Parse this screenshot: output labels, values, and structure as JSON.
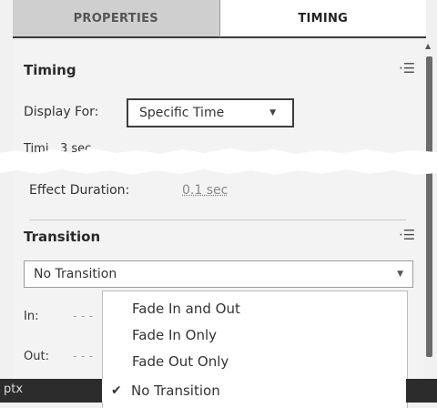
{
  "tabs": [
    {
      "label": "PROPERTIES"
    },
    {
      "label": "TIMING"
    }
  ],
  "timing_section": {
    "title": "Timing",
    "display_for_label": "Display For:",
    "display_for_value": "Specific Time",
    "timing_label": "Timi",
    "timing_value": "3 sec",
    "effect_duration_label": "Effect Duration:",
    "effect_duration_value": "0.1 sec"
  },
  "transition_section": {
    "title": "Transition",
    "selected": "No Transition",
    "in_label": "In:",
    "out_label": "Out:",
    "options": [
      "Fade In and Out",
      "Fade In Only",
      "Fade Out Only",
      "No Transition"
    ],
    "checked_option": "No Transition"
  },
  "bottom_bar": {
    "text": "ptx"
  },
  "colors": {
    "accent": "#3d3d3d",
    "panel_bg": "#f3f3f3",
    "dark_bar": "#2c2c2c"
  }
}
